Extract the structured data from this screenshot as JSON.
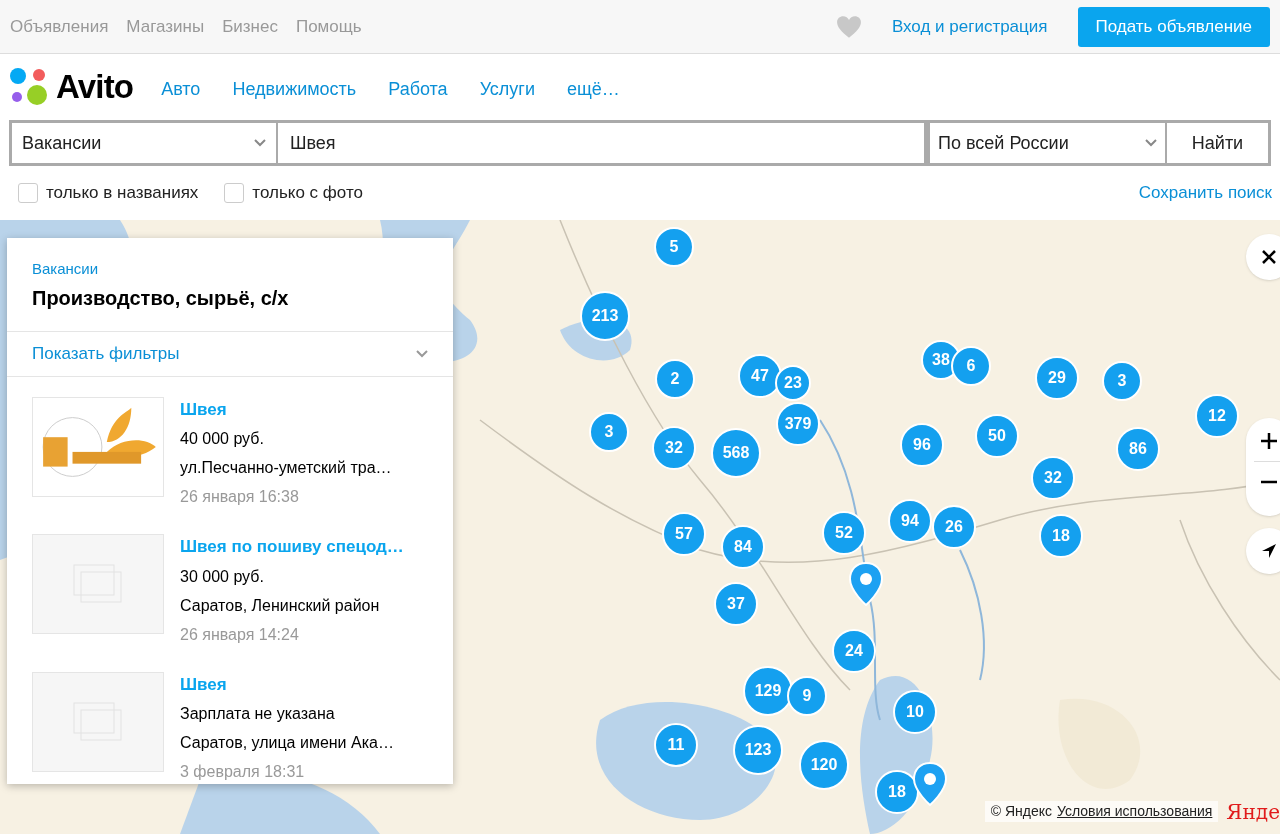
{
  "top_nav": {
    "links": [
      "Объявления",
      "Магазины",
      "Бизнес",
      "Помощь"
    ],
    "login": "Вход и регистрация",
    "post_button": "Подать объявление"
  },
  "header": {
    "logo": "Avito",
    "categories": [
      "Авто",
      "Недвижимость",
      "Работа",
      "Услуги",
      "ещё…"
    ]
  },
  "search": {
    "category": "Вакансии",
    "query": "Швея",
    "region": "По всей России",
    "submit": "Найти",
    "options": [
      {
        "label": "только в названиях",
        "checked": false
      },
      {
        "label": "только с фото",
        "checked": false
      }
    ],
    "save": "Сохранить поиск"
  },
  "results_panel": {
    "breadcrumb": "Вакансии",
    "title": "Производство, сырьё, с/х",
    "filters_toggle": "Показать фильтры",
    "filters_expanded": false,
    "listings": [
      {
        "title": "Швея",
        "price": "40 000 руб.",
        "address": "ул.Песчанно-уметский тра…",
        "date": "26 января 16:38",
        "kind": "picture"
      },
      {
        "title": "Швея по пошиву спецод…",
        "price": "30 000 руб.",
        "address": "Саратов, Ленинский район",
        "date": "26 января 14:24",
        "kind": "placeholder"
      },
      {
        "title": "Швея",
        "price": "Зарплата не указана",
        "address": "Саратов, улица имени Ака…",
        "date": "3 февраля 18:31",
        "kind": "placeholder"
      }
    ]
  },
  "map": {
    "clusters": [
      {
        "count": "5"
      },
      {
        "count": "213"
      },
      {
        "count": "2"
      },
      {
        "count": "47"
      },
      {
        "count": "23"
      },
      {
        "count": "379"
      },
      {
        "count": "3"
      },
      {
        "count": "32"
      },
      {
        "count": "568"
      },
      {
        "count": "38"
      },
      {
        "count": "6"
      },
      {
        "count": "29"
      },
      {
        "count": "3"
      },
      {
        "count": "12"
      },
      {
        "count": "96"
      },
      {
        "count": "50"
      },
      {
        "count": "86"
      },
      {
        "count": "32"
      },
      {
        "count": "57"
      },
      {
        "count": "84"
      },
      {
        "count": "52"
      },
      {
        "count": "94"
      },
      {
        "count": "26"
      },
      {
        "count": "18"
      },
      {
        "count": "37"
      },
      {
        "count": "24"
      },
      {
        "count": "129"
      },
      {
        "count": "9"
      },
      {
        "count": "10"
      },
      {
        "count": "11"
      },
      {
        "count": "123"
      },
      {
        "count": "120"
      },
      {
        "count": "18"
      }
    ],
    "attribution": "© Яндекс",
    "terms": "Условия использования",
    "provider_logo": "Янде"
  }
}
